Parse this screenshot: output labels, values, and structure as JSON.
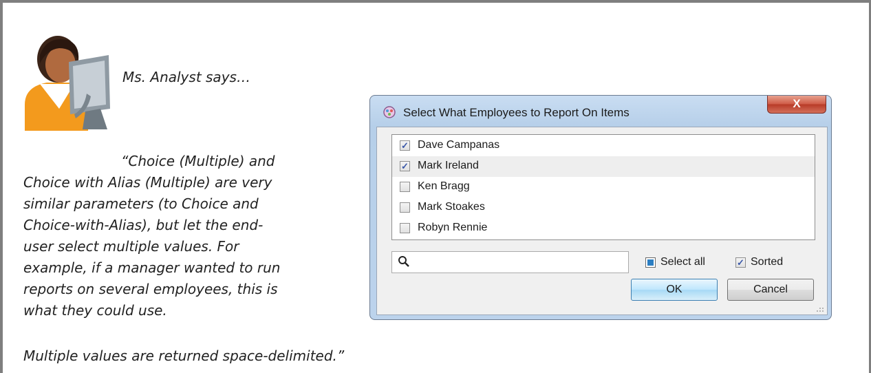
{
  "page": {
    "says": "Ms. Analyst says…",
    "quote_lines": [
      "“Choice (Multiple) and",
      "Choice with Alias (Multiple) are very",
      "similar parameters (to Choice and",
      "Choice-with-Alias), but let the end-",
      "user select multiple values. For",
      "example, if a manager wanted to run",
      "reports on several employees, this is",
      "what they could use."
    ],
    "footer": "Multiple values are returned space-delimited.”"
  },
  "dialog": {
    "title": "Select What Employees to Report On Items",
    "close_label": "X",
    "items": [
      {
        "label": "Dave Campanas",
        "checked": true
      },
      {
        "label": "Mark Ireland",
        "checked": true
      },
      {
        "label": "Ken Bragg",
        "checked": false
      },
      {
        "label": "Mark Stoakes",
        "checked": false
      },
      {
        "label": "Robyn Rennie",
        "checked": false
      }
    ],
    "search_value": "",
    "select_all_label": "Select all",
    "sorted_label": "Sorted",
    "sorted_checked": true,
    "ok_label": "OK",
    "cancel_label": "Cancel",
    "check_mark": "✓"
  },
  "colors": {
    "dialog_bg": "#b6cfe9",
    "close_red": "#c94a36",
    "select_all_blue": "#2c7ec2"
  }
}
